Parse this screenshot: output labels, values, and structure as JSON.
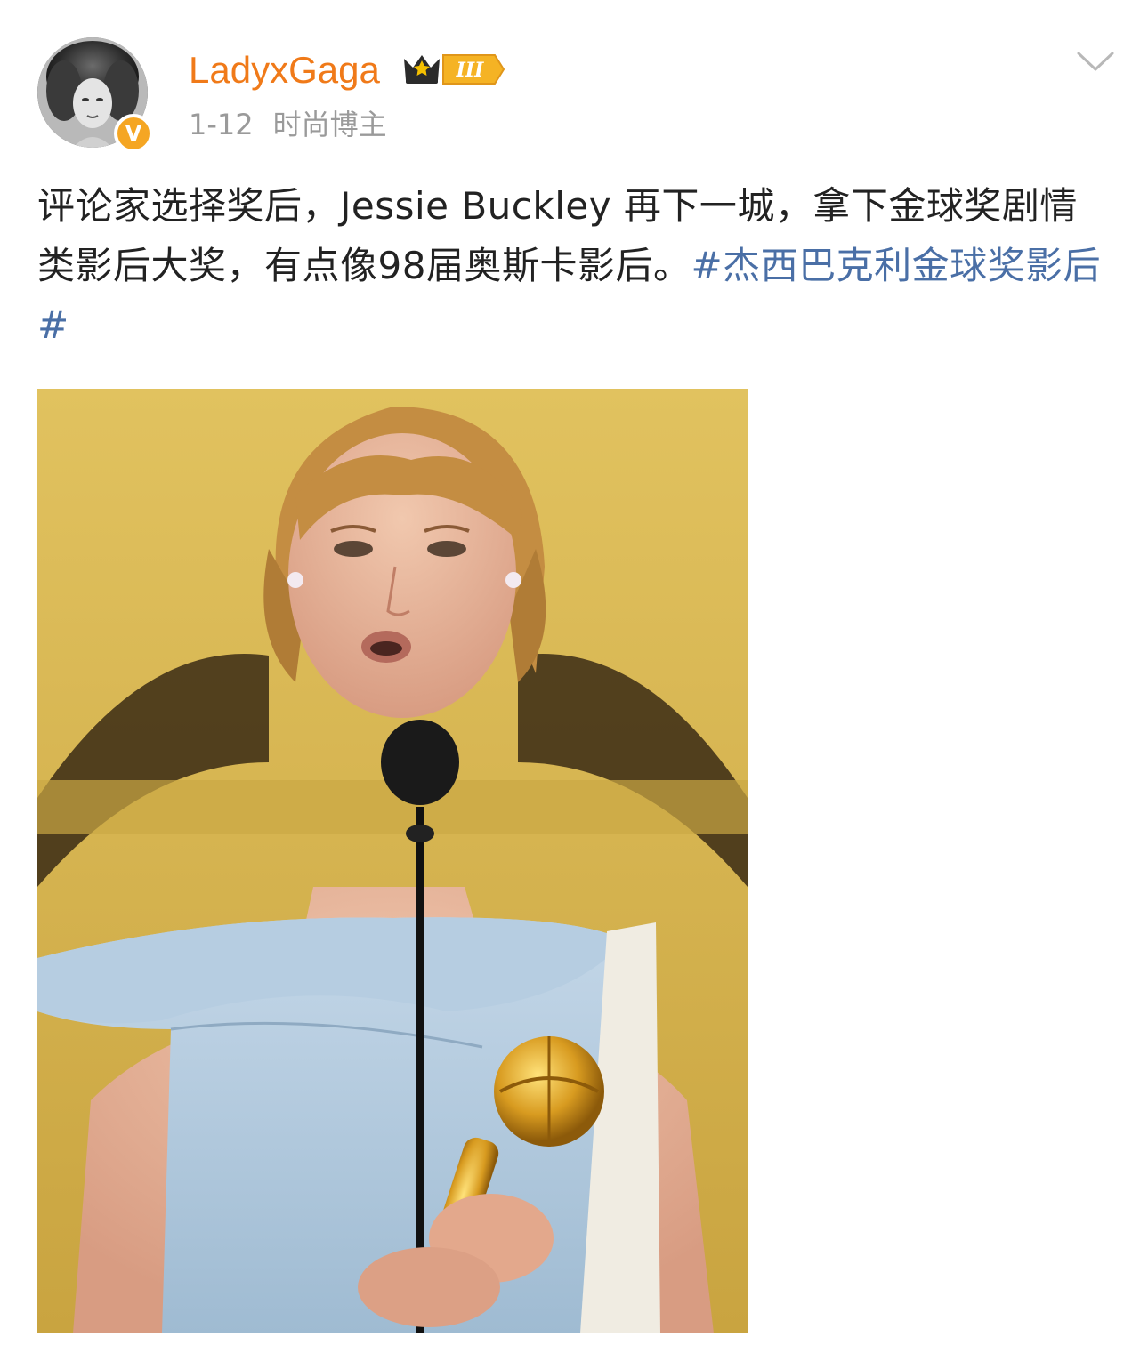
{
  "post": {
    "author": {
      "username": "LadyxGaga",
      "verified_badge": "V",
      "vip_badge": {
        "icon": "crown-icon",
        "level": "III",
        "color": "#f5b324"
      }
    },
    "meta": {
      "date": "1-12",
      "tag": "时尚博主"
    },
    "content": {
      "text": "评论家选择奖后，Jessie Buckley 再下一城，拿下金球奖剧情类影后大奖，有点像98届奥斯卡影后。",
      "hashtag": "#杰西巴克利金球奖影后#"
    },
    "image": {
      "icon": "photo-image"
    },
    "menu_icon": "chevron-down-icon"
  },
  "colors": {
    "username": "#f07a19",
    "hashtag": "#4a6fa6",
    "meta": "#9a9a9a",
    "text": "#222222",
    "badge": "#f5a623"
  }
}
